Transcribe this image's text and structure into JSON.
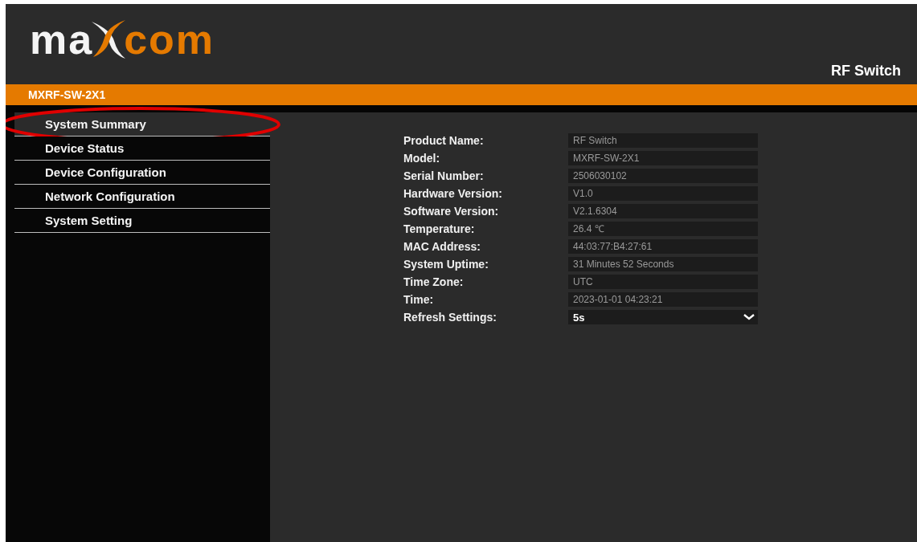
{
  "logo": {
    "part_1": "ma",
    "part_2": "com"
  },
  "header": {
    "product": "RF Switch"
  },
  "model_bar": {
    "label": "MXRF-SW-2X1"
  },
  "sidebar": {
    "items": [
      {
        "label": "System Summary",
        "selected": true,
        "circled": true
      },
      {
        "label": "Device Status",
        "selected": false,
        "circled": false
      },
      {
        "label": "Device Configuration",
        "selected": false,
        "circled": false
      },
      {
        "label": "Network Configuration",
        "selected": false,
        "circled": false
      },
      {
        "label": "System Setting",
        "selected": false,
        "circled": false
      }
    ]
  },
  "summary": {
    "fields": [
      {
        "label": "Product Name:",
        "value": "RF Switch",
        "kind": "text"
      },
      {
        "label": "Model:",
        "value": "MXRF-SW-2X1",
        "kind": "text"
      },
      {
        "label": "Serial Number:",
        "value": "2506030102",
        "kind": "text"
      },
      {
        "label": "Hardware Version:",
        "value": "V1.0",
        "kind": "text"
      },
      {
        "label": "Software Version:",
        "value": "V2.1.6304",
        "kind": "text"
      },
      {
        "label": "Temperature:",
        "value": "26.4 ℃",
        "kind": "text"
      },
      {
        "label": "MAC Address:",
        "value": "44:03:77:B4:27:61",
        "kind": "text"
      },
      {
        "label": "System Uptime:",
        "value": "31 Minutes 52 Seconds",
        "kind": "text"
      },
      {
        "label": "Time Zone:",
        "value": "UTC",
        "kind": "text"
      },
      {
        "label": "Time:",
        "value": "2023-01-01 04:23:21",
        "kind": "text"
      },
      {
        "label": "Refresh Settings:",
        "value": "5s",
        "kind": "select"
      }
    ]
  }
}
